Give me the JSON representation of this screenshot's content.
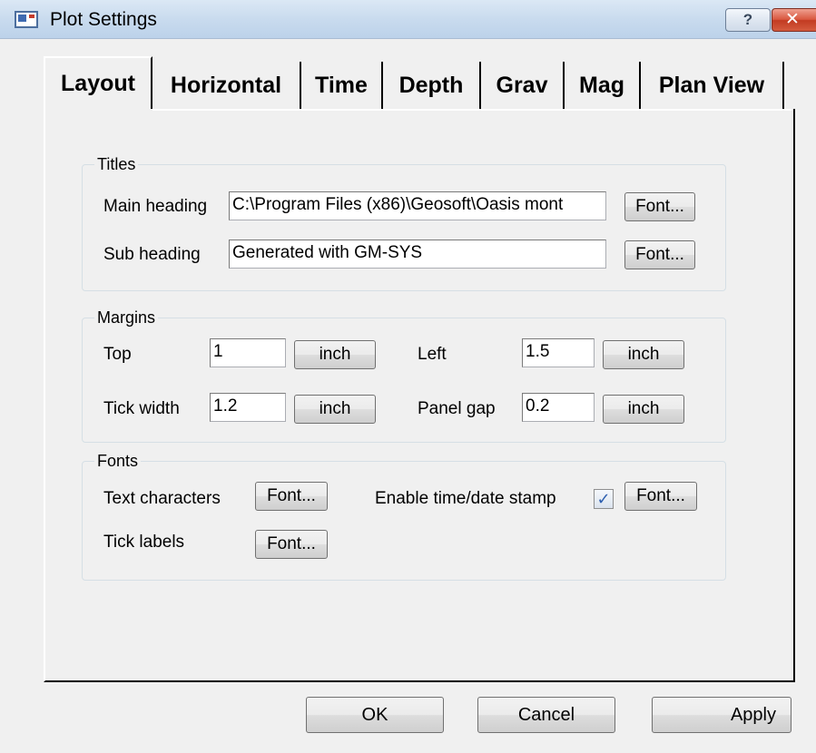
{
  "window": {
    "title": "Plot Settings",
    "help_label": "?",
    "close_label": "✕"
  },
  "tabs": [
    {
      "label": "Layout"
    },
    {
      "label": "Horizontal"
    },
    {
      "label": "Time"
    },
    {
      "label": "Depth"
    },
    {
      "label": "Grav"
    },
    {
      "label": "Mag"
    },
    {
      "label": "Plan View"
    }
  ],
  "titles_group": {
    "label": "Titles",
    "main_heading_label": "Main heading",
    "main_heading_value": "C:\\Program Files (x86)\\Geosoft\\Oasis mont",
    "sub_heading_label": "Sub heading",
    "sub_heading_value": "Generated with GM-SYS",
    "font_button": "Font..."
  },
  "margins_group": {
    "label": "Margins",
    "top_label": "Top",
    "top_value": "1",
    "left_label": "Left",
    "left_value": "1.5",
    "tick_width_label": "Tick width",
    "tick_width_value": "1.2",
    "panel_gap_label": "Panel gap",
    "panel_gap_value": "0.2",
    "unit_button": "inch"
  },
  "fonts_group": {
    "label": "Fonts",
    "text_characters_label": "Text characters",
    "tick_labels_label": "Tick labels",
    "timestamp_label": "Enable time/date stamp",
    "timestamp_checked": true,
    "checkmark": "✓",
    "font_button": "Font..."
  },
  "footer": {
    "ok": "OK",
    "cancel": "Cancel",
    "apply": "Apply"
  }
}
